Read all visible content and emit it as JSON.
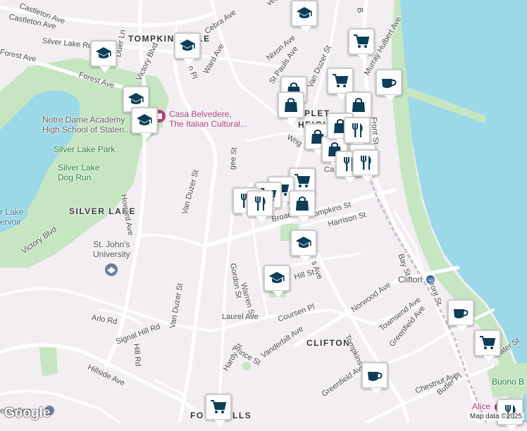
{
  "colors": {
    "water": "#9bd8e8",
    "park": "#c6e6c2",
    "road": "#ffffff",
    "road_casing": "#d6d0d8",
    "rail": "#c9c3c9",
    "land": "#f2eef2",
    "pin_icon": "#0d3d57"
  },
  "streets": {
    "castleton_ave_top": "Castleton Ave",
    "castleton_ave": "Castleton Ave",
    "silver_lake_rd": "Silver Lake Rd",
    "forest_ave": "Forest Ave",
    "forest_ave_w": "Forest Ave",
    "duer_ln": "Duer Ln",
    "victory_blvd_top": "Victory Blvd",
    "cebra_ave": "Cebra Ave",
    "ward_ave": "Ward Ave",
    "nixon_ave": "Nixon Ave",
    "st_pauls_ave": "St Pauls Ave",
    "van_duzer_st_top": "Van Duzer St",
    "murray_hulbert": "Murray Hulbert Ave",
    "front_st": "Front St",
    "front_st_2": "Front St",
    "howard_ave": "Howard Ave",
    "van_duzer_st": "Van Duzer St",
    "van_duzer_st_2": "Van Duzer St",
    "victory_blvd": "Victory Blvd",
    "wright": "Wrig",
    "car": "Ca",
    "broad": "Broad",
    "tompkins_st": "Tompkins St",
    "harrison_st": "Harrison St",
    "gordon_st": "Gordon St",
    "warren_st": "Warren St",
    "hill_st": "Hill St",
    "s_ave": "s Ave",
    "bay_st": "Bay St",
    "norwood_ave": "Norwood Ave",
    "townsend_ave": "Townsend Ave",
    "greenfield_ave": "Greenfield Ave",
    "greenfield_ave_2": "Greenfield Ave",
    "arlo_rd": "Arlo Rd",
    "laurel_ave": "Laurel Ave",
    "coursen_pl": "Coursen Pl",
    "vanderbilt_ave": "Vanderbilt Ave",
    "tompkins_ave": "Tompkins",
    "signal_hill": "Signal Hill Rd",
    "hill_rd": "Hill Rd",
    "prince_st": "Prince St",
    "hardy_st": "Hardy St",
    "hillside_ave": "Hillside Ave",
    "chestnut_ave": "Chestnut Ave",
    "butler_pl": "Butler Pl",
    "ater_st": "ater St",
    "n_pl": "n Pl",
    "gee_st": "gee St",
    "ves_ave": "ves Ave",
    "b": "B"
  },
  "areas": {
    "tompkinsville": "TOMPKINSVILLE",
    "silver_lake": "SILVER LAKE",
    "clifton": "CLIFTON",
    "stapleton_heights_1": "PLET",
    "stapleton_heights_2": "HEIGH",
    "fox_hills": "FO",
    "fox_hills_2": "LLS"
  },
  "pois": {
    "notre_dame": [
      "Notre Dame Academy",
      "High School of Staten..."
    ],
    "casa_belvedere": [
      "Casa Belvedere,",
      "The Italian Cultural..."
    ],
    "silver_lake_park": "Silver Lake Park",
    "silver_lake_dog_run": [
      "Silver Lake",
      "Dog Run"
    ],
    "lake_reservoir": [
      "r Lake",
      "ervoir"
    ],
    "st_johns": [
      "St. John's",
      "University"
    ],
    "clifton_station": "Clifton",
    "buono": "Buono B",
    "alice": "Alice",
    "college": "e Colleg"
  },
  "attribution": "Map data ©2025",
  "logo": "Google"
}
